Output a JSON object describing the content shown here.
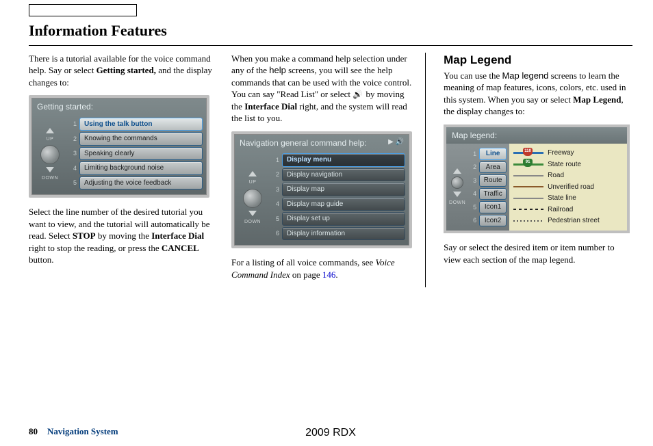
{
  "header": {
    "title": "Information Features"
  },
  "col1": {
    "p1_a": "There is a tutorial available for the voice command help. Say or select ",
    "p1_b": "Getting started,",
    "p1_c": " and the display changes to:",
    "screen_title": "Getting started:",
    "rows": [
      "Using the talk button",
      "Knowing the commands",
      "Speaking clearly",
      "Limiting background noise",
      "Adjusting the voice feedback"
    ],
    "nums": [
      "1",
      "2",
      "3",
      "4",
      "5"
    ],
    "p2_a": "Select the line number of the desired tutorial you want to view, and the tutorial will automatically be read. Select ",
    "p2_b": "STOP",
    "p2_c": " by moving the ",
    "p2_d": "Interface Dial",
    "p2_e": " right to stop the reading, or press the ",
    "p2_f": "CANCEL",
    "p2_g": " button."
  },
  "col2": {
    "p1_a": "When you make a command help selection under any of the ",
    "p1_b": "help",
    "p1_c": " screens, you will see the help commands that can be used with the voice control. You can say \"Read List\" or select ",
    "p1_d": " by moving the ",
    "p1_e": "Interface Dial",
    "p1_f": " right, and the system will read the list to you.",
    "screen_title": "Navigation general command help:",
    "rows": [
      "Display menu",
      "Display navigation",
      "Display map",
      "Display map guide",
      "Display set up",
      "Display information"
    ],
    "nums": [
      "1",
      "2",
      "3",
      "4",
      "5",
      "6"
    ],
    "p2_a": "For a listing of all voice commands, see ",
    "p2_b": "Voice Command Index",
    "p2_c": " on page ",
    "p2_d": "146",
    "p2_e": "."
  },
  "col3": {
    "h2": "Map Legend",
    "p1_a": "You can use the ",
    "p1_b": "Map legend",
    "p1_c": " screens to learn the meaning of map features, icons, colors, etc. used in this system. When you say or select ",
    "p1_d": "Map Legend",
    "p1_e": ", the display changes to:",
    "screen_title": "Map legend:",
    "left_rows": [
      "Line",
      "Area",
      "Route",
      "Traffic",
      "Icon1",
      "Icon2"
    ],
    "left_nums": [
      "1",
      "2",
      "3",
      "4",
      "5",
      "6"
    ],
    "legend": [
      {
        "label": "Freeway",
        "shield": "110",
        "shield_cls": "red",
        "line_cls": "blue"
      },
      {
        "label": "State route",
        "shield": "91",
        "shield_cls": "grn",
        "line_cls": "green"
      },
      {
        "label": "Road",
        "line_cls": "gray"
      },
      {
        "label": "Unverified road",
        "line_cls": "brown"
      },
      {
        "label": "State line",
        "line_cls": "gray"
      },
      {
        "label": "Railroad",
        "line_cls": "rail"
      },
      {
        "label": "Pedestrian street",
        "line_cls": "dotted"
      }
    ],
    "p2": "Say or select the desired item or item number to view each section of the map legend."
  },
  "footer": {
    "page": "80",
    "section": "Navigation System",
    "model": "2009 RDX"
  },
  "knob": {
    "up": "UP",
    "down": "DOWN"
  }
}
